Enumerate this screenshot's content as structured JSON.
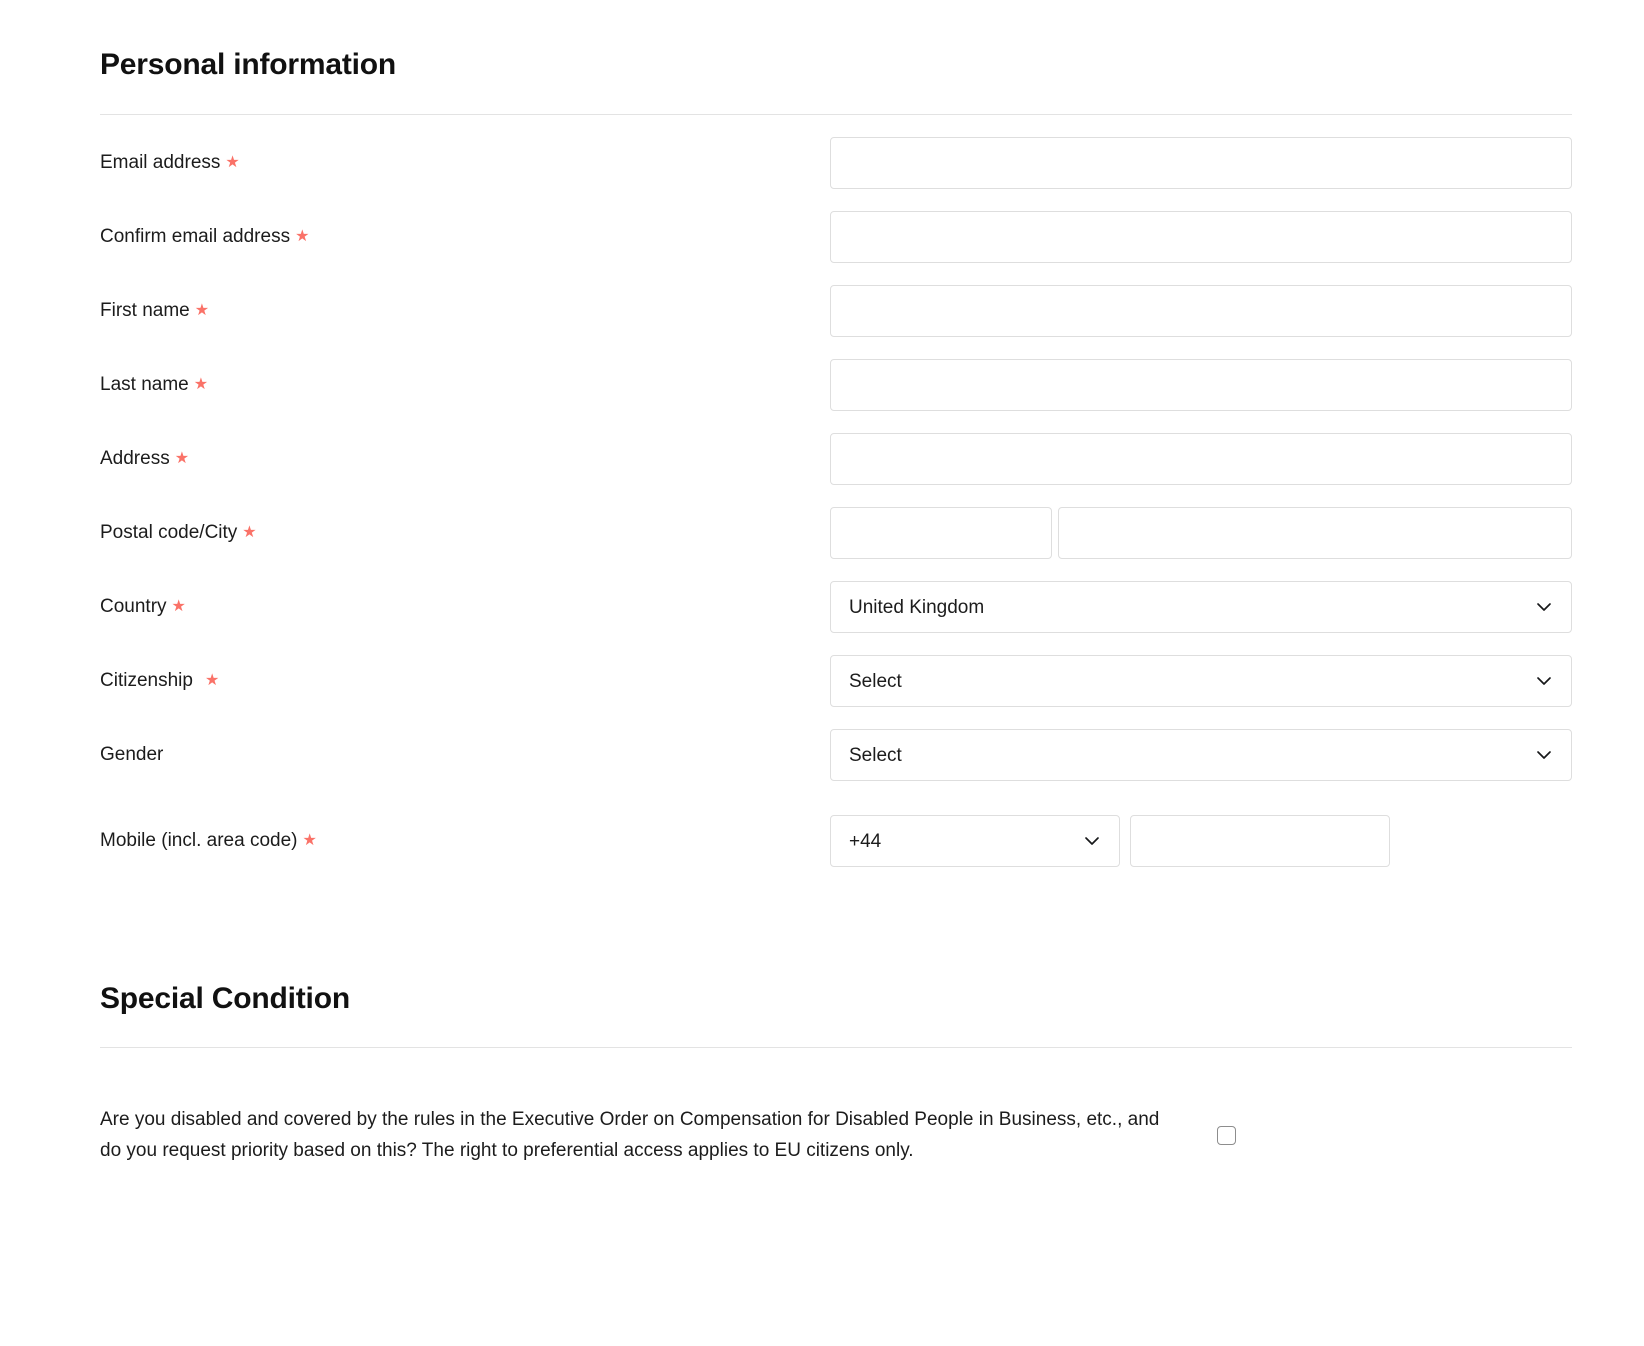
{
  "personal": {
    "heading": "Personal information",
    "required_marker": "★",
    "fields": [
      {
        "label": "Email address",
        "required": true,
        "control": "text",
        "value": "",
        "placeholder": ""
      },
      {
        "label": "Confirm email address",
        "required": true,
        "control": "text",
        "value": "",
        "placeholder": ""
      },
      {
        "label": "First name",
        "required": true,
        "control": "text",
        "value": "",
        "placeholder": ""
      },
      {
        "label": "Last name",
        "required": true,
        "control": "text",
        "value": "",
        "placeholder": ""
      },
      {
        "label": "Address",
        "required": true,
        "control": "text",
        "value": "",
        "placeholder": ""
      },
      {
        "label": "Postal code/City",
        "required": true,
        "control": "split",
        "value": "",
        "placeholder": ""
      },
      {
        "label": "Country",
        "required": true,
        "control": "select",
        "value": "United Kingdom"
      },
      {
        "label": "Citizenship",
        "required": true,
        "control": "select",
        "value": "Select"
      },
      {
        "label": "Gender",
        "required": false,
        "control": "select",
        "value": "Select"
      },
      {
        "label": "Mobile (incl. area code)",
        "required": true,
        "control": "phone",
        "value": "+44"
      }
    ],
    "postal_code_value": "",
    "city_value": "",
    "phone_dial_code": "+44",
    "phone_number_value": ""
  },
  "special": {
    "heading": "Special Condition",
    "question": "Are you disabled and covered by the rules in the Executive Order on Compensation for Disabled People in Business, etc., and do you request priority based on this? The right to preferential access applies to EU citizens only.",
    "checkbox_checked": false
  },
  "colors": {
    "required_asterisk": "#fa7268",
    "text": "#1c1c1c",
    "border": "#dedede",
    "rule": "#e3e3e3",
    "background": "#ffffff"
  }
}
